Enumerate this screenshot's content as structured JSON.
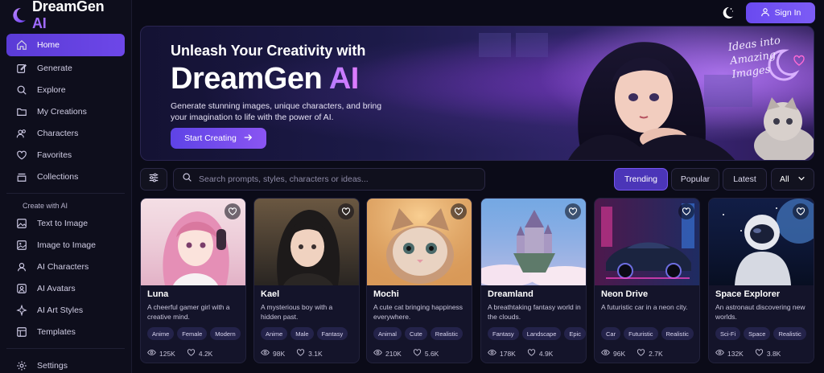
{
  "brand": {
    "name": "DreamGen",
    "ai": "AI"
  },
  "nav": {
    "home": "Home",
    "generate": "Generate",
    "explore": "Explore",
    "my_creations": "My Creations",
    "characters": "Characters",
    "favorites": "Favorites",
    "collections": "Collections",
    "section_label": "Create with AI",
    "text_to_image": "Text to Image",
    "image_to_image": "Image to Image",
    "ai_characters": "AI Characters",
    "ai_avatars": "AI Avatars",
    "ai_art_styles": "AI Art Styles",
    "templates": "Templates",
    "settings": "Settings"
  },
  "header": {
    "signin": "Sign In"
  },
  "hero": {
    "subtitle": "Unleash Your Creativity with",
    "title": "DreamGen",
    "title_ai": "AI",
    "description": "Generate stunning images, unique characters, and bring your imagination to life with the power of AI.",
    "cta": "Start Creating",
    "script": "Ideas into Amazing Images"
  },
  "search": {
    "placeholder": "Search prompts, styles, characters or ideas..."
  },
  "sort": {
    "trending": "Trending",
    "popular": "Popular",
    "latest": "Latest",
    "all": "All"
  },
  "cards": [
    {
      "title": "Luna",
      "desc": "A cheerful gamer girl with a creative mind.",
      "tags": [
        "Anime",
        "Female",
        "Modern"
      ],
      "views": "125K",
      "likes": "4.2K"
    },
    {
      "title": "Kael",
      "desc": "A mysterious boy with a hidden past.",
      "tags": [
        "Anime",
        "Male",
        "Fantasy"
      ],
      "views": "98K",
      "likes": "3.1K"
    },
    {
      "title": "Mochi",
      "desc": "A cute cat bringing happiness everywhere.",
      "tags": [
        "Animal",
        "Cute",
        "Realistic"
      ],
      "views": "210K",
      "likes": "5.6K"
    },
    {
      "title": "Dreamland",
      "desc": "A breathtaking fantasy world in the clouds.",
      "tags": [
        "Fantasy",
        "Landscape",
        "Epic"
      ],
      "views": "178K",
      "likes": "4.9K"
    },
    {
      "title": "Neon Drive",
      "desc": "A futuristic car in a neon city.",
      "tags": [
        "Car",
        "Futuristic",
        "Realistic"
      ],
      "views": "96K",
      "likes": "2.7K"
    },
    {
      "title": "Space Explorer",
      "desc": "An astronaut discovering new worlds.",
      "tags": [
        "Sci-Fi",
        "Space",
        "Realistic"
      ],
      "views": "132K",
      "likes": "3.8K"
    }
  ],
  "colors": {
    "accent": "#6a4af0",
    "background": "#0b0b18",
    "card": "#14142a"
  }
}
